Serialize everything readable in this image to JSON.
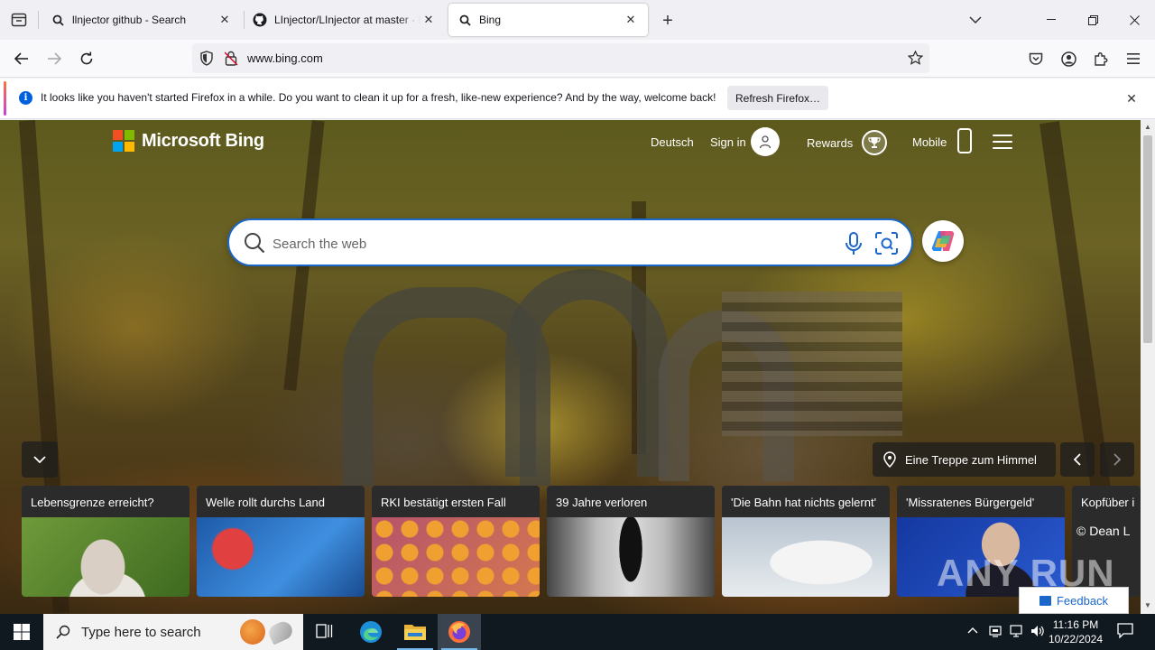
{
  "browser": {
    "tabs": [
      {
        "title": "llnjector github - Search",
        "favicon": "search-icon",
        "active": false
      },
      {
        "title": "LInjector/LInjector at master · It",
        "favicon": "github-icon",
        "active": false
      },
      {
        "title": "Bing",
        "favicon": "search-icon",
        "active": true
      }
    ],
    "url": "www.bing.com"
  },
  "notification": {
    "message": "It looks like you haven't started Firefox in a while. Do you want to clean it up for a fresh, like-new experience? And by the way, welcome back!",
    "button_label": "Refresh Firefox…",
    "info_glyph": "i"
  },
  "bing": {
    "brand": "Microsoft Bing",
    "logo_colors": [
      "#f25022",
      "#7fba00",
      "#00a4ef",
      "#ffb900"
    ],
    "accent_color": "#1a66c9",
    "nav": {
      "language": "Deutsch",
      "sign_in": "Sign in",
      "rewards": "Rewards",
      "mobile": "Mobile"
    },
    "search": {
      "placeholder": "Search the web"
    },
    "image_caption": "Eine Treppe zum Himmel",
    "copyright": "© Dean L",
    "feedback": "Feedback",
    "watermark": "ANY RUN",
    "news": [
      {
        "title": "Lebensgrenze erreicht?"
      },
      {
        "title": "Welle rollt durchs Land"
      },
      {
        "title": "RKI bestätigt ersten Fall"
      },
      {
        "title": "39 Jahre verloren"
      },
      {
        "title": "'Die Bahn hat nichts gelernt'"
      },
      {
        "title": "'Missratenes Bürgergeld'"
      },
      {
        "title": "Kopfüber i"
      }
    ]
  },
  "taskbar": {
    "search_placeholder": "Type here to search",
    "time": "11:16 PM",
    "date": "10/22/2024",
    "apps": [
      "task-view-icon",
      "edge-icon",
      "file-explorer-icon",
      "firefox-icon"
    ]
  }
}
